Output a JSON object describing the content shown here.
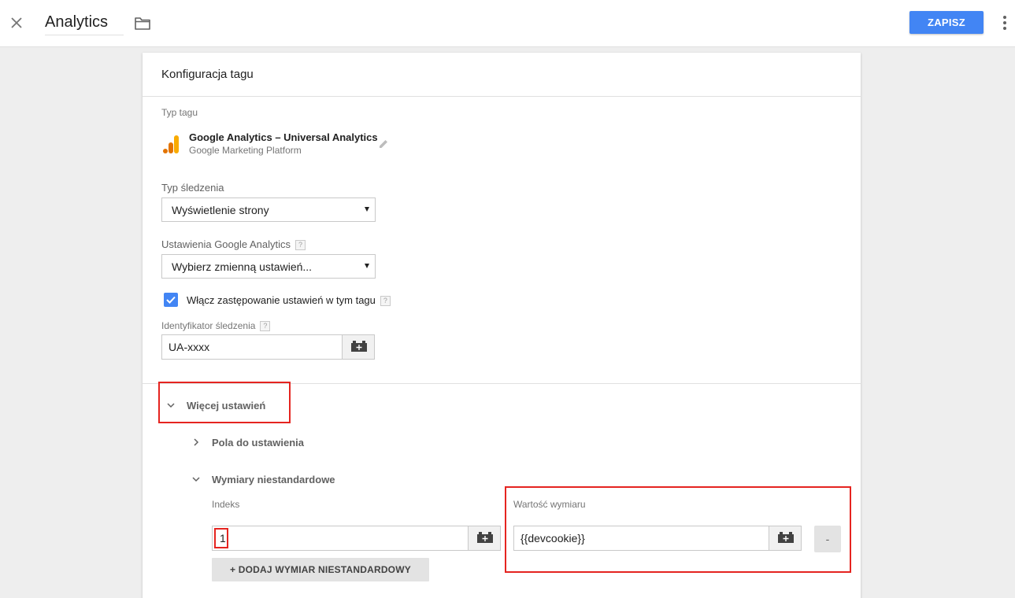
{
  "header": {
    "title": "Analytics",
    "save_label": "ZAPISZ"
  },
  "card": {
    "title": "Konfiguracja tagu",
    "tag_type_label": "Typ tagu",
    "tag_name": "Google Analytics – Universal Analytics",
    "tag_platform": "Google Marketing Platform",
    "tracking_type_label": "Typ śledzenia",
    "tracking_type_value": "Wyświetlenie strony",
    "ga_settings_label": "Ustawienia Google Analytics",
    "ga_settings_value": "Wybierz zmienną ustawień...",
    "override_label": "Włącz zastępowanie ustawień w tym tagu",
    "override_checked": true,
    "tracking_id_label": "Identyfikator śledzenia",
    "tracking_id_value": "UA-xxxx",
    "help_glyph": "?"
  },
  "more_settings": {
    "label": "Więcej ustawień",
    "fields_label": "Pola do ustawienia",
    "custom_dims_label": "Wymiary niestandardowe",
    "index_label": "Indeks",
    "dim_value_label": "Wartość wymiaru",
    "index_value": "1",
    "dim_value": "{{devcookie}}",
    "add_dim_label": "+ DODAJ WYMIAR NIESTANDARDOWY",
    "remove_label": "-"
  },
  "colors": {
    "accent": "#4285f4",
    "highlight": "#e52420",
    "ga_orange": "#f9ab00",
    "ga_dark_orange": "#e37400"
  }
}
